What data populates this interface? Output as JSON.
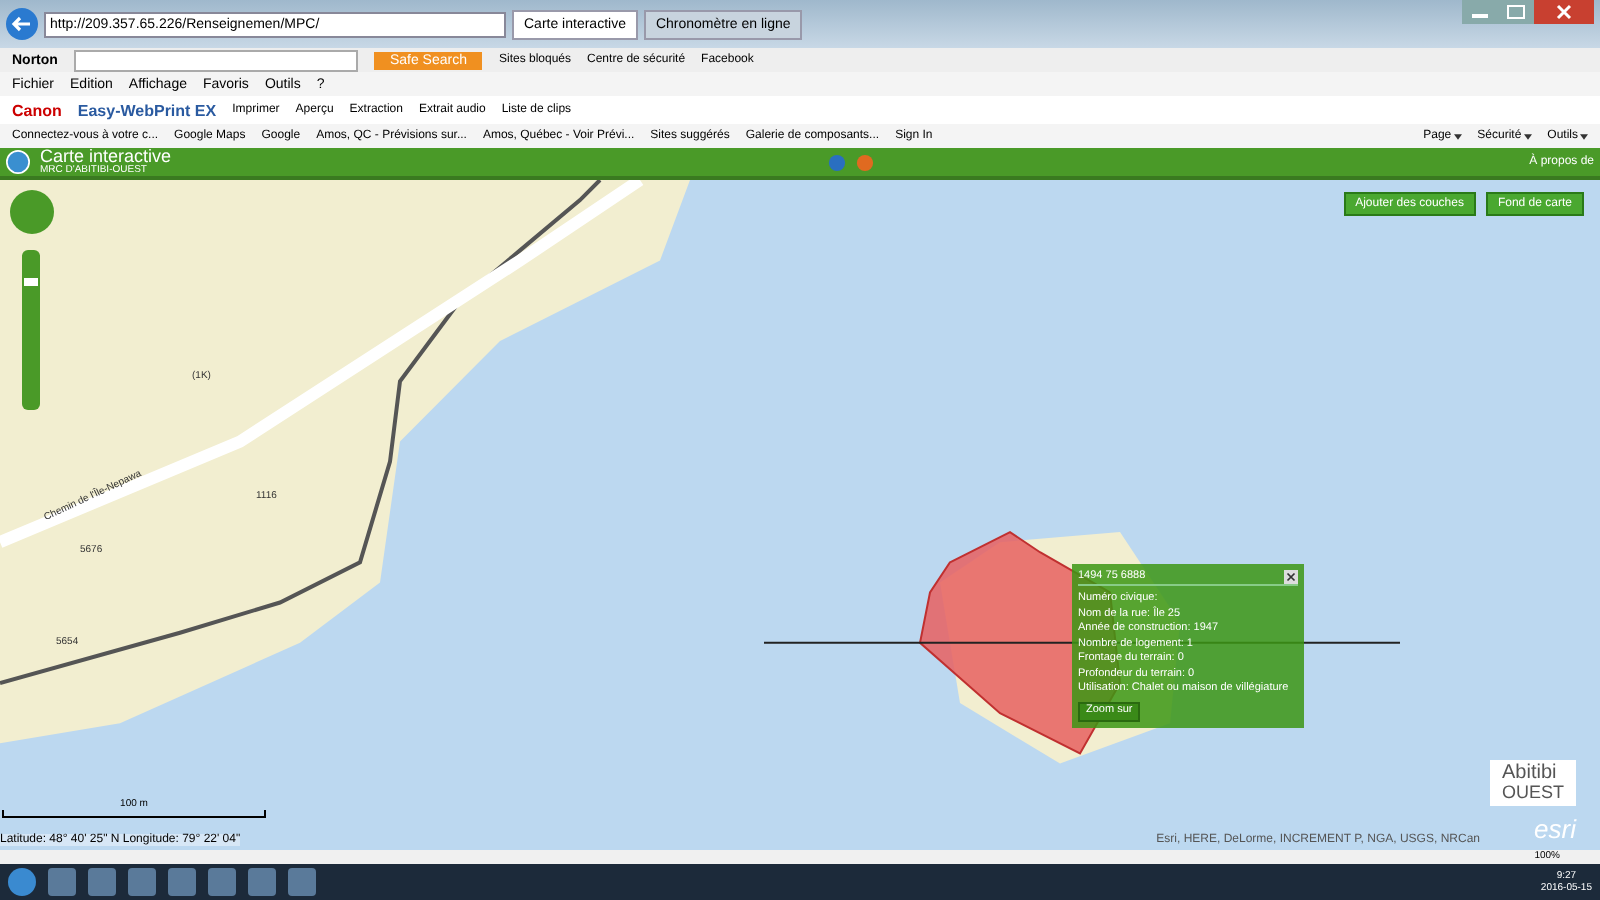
{
  "browser": {
    "address": "http://209.357.65.226/Renseignemen/MPC/",
    "tabs": [
      {
        "label": "Carte interactive",
        "selected": true
      },
      {
        "label": "Chronomètre en ligne",
        "selected": false
      }
    ],
    "norton": {
      "brand": "Norton",
      "search_button": "Safe Search",
      "items": [
        "Sites bloqués",
        "Centre de sécurité",
        "Facebook"
      ]
    },
    "menu": [
      "Fichier",
      "Edition",
      "Affichage",
      "Favoris",
      "Outils",
      "?"
    ],
    "canon": {
      "brand": "Canon",
      "product": "Easy-WebPrint EX",
      "items": [
        "Imprimer",
        "Aperçu",
        "Extraction",
        "Extrait audio",
        "Liste de clips"
      ]
    },
    "favorites": [
      "Connectez-vous à votre c...",
      "Google Maps",
      "Google",
      "Amos, QC - Prévisions sur...",
      "Amos, Québec - Voir Prévi...",
      "Sites suggérés",
      "Galerie de composants...",
      "Sign In"
    ],
    "commands": [
      "Page",
      "Sécurité",
      "Outils"
    ]
  },
  "app": {
    "title": "Carte interactive",
    "subtitle": "MRC D'ABITIBI-OUEST",
    "about": "À propos de"
  },
  "map": {
    "buttons": [
      "Ajouter des couches",
      "Fond de carte"
    ],
    "labels": [
      "Chemin de l'Île-Nepawa",
      "(1K)",
      "5676",
      "5654",
      "1116"
    ],
    "zoom": {
      "level": 0.82
    },
    "scale": "100 m",
    "coordinates": "Latitude: 48° 40' 25\" N Longitude: 79° 22' 04\"",
    "attribution": "Esri, HERE, DeLorme, INCREMENT P, NGA, USGS, NRCan",
    "logo": {
      "name": "Abitibi",
      "sub": "OUEST",
      "esri": "esri"
    },
    "popup": {
      "title": "1494 75 6888",
      "lines": [
        "Numéro civique:",
        "Nom de la rue: Île 25",
        "Année de construction: 1947",
        "Nombre de logement: 1",
        "Frontage du terrain: 0",
        "Profondeur du terrain: 0",
        "Utilisation: Chalet ou maison de villégiature"
      ],
      "button": "Zoom sur"
    }
  },
  "status": {
    "zoom": "100%"
  },
  "taskbar": {
    "time": "9:27",
    "date": "2016-05-15"
  }
}
